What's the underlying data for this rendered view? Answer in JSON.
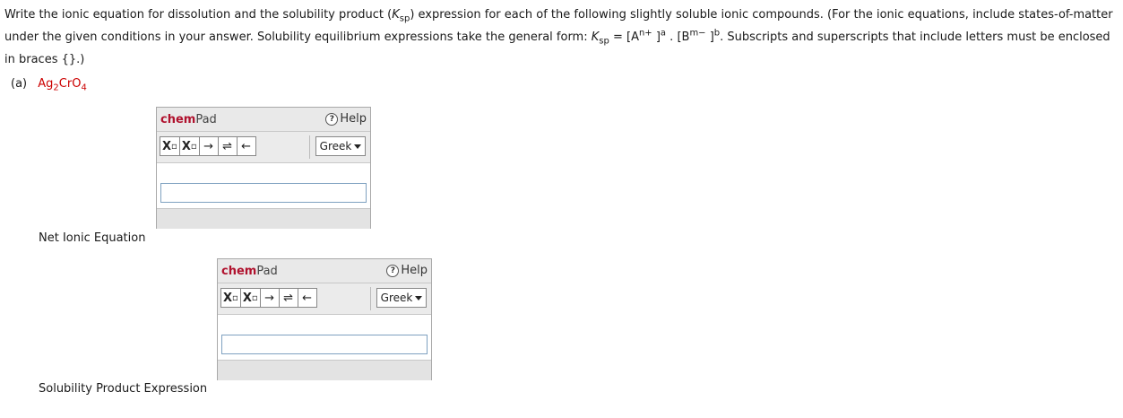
{
  "instructions": {
    "p1": "Write the ionic equation for dissolution and the solubility product (",
    "k": "K",
    "ksub": "sp",
    "p2": ") expression for each of the following slightly soluble ionic compounds. (For the ionic equations, include states-of-matter under the given conditions in your answer. Solubility equilibrium expressions take the general form: ",
    "p3": " = [A",
    "sup1": "n+",
    "p4": " ]",
    "sup2": "a",
    "p5": " . [B",
    "sup3": "m−",
    "p6": " ]",
    "sup4": "b",
    "p7": ". Subscripts and superscripts that include letters must be enclosed in braces {}.)"
  },
  "part": {
    "label": "(a)",
    "compound_a": "Ag",
    "compound_sub1": "2",
    "compound_b": "CrO",
    "compound_sub2": "4"
  },
  "fields": {
    "net_ionic_label": "Net Ionic Equation",
    "solubility_label": "Solubility Product Expression"
  },
  "chempad": {
    "title_bold": "chem",
    "title_rest": "Pad",
    "help": "Help",
    "greek": "Greek",
    "sub_btn": "X",
    "sup_btn": "X",
    "arrow": "→",
    "equilibrium": "⇌",
    "left_arrow": "←",
    "box_glyph": "▫",
    "help_glyph": "?"
  },
  "inputs": {
    "net_ionic_value": "",
    "solubility_value": ""
  }
}
